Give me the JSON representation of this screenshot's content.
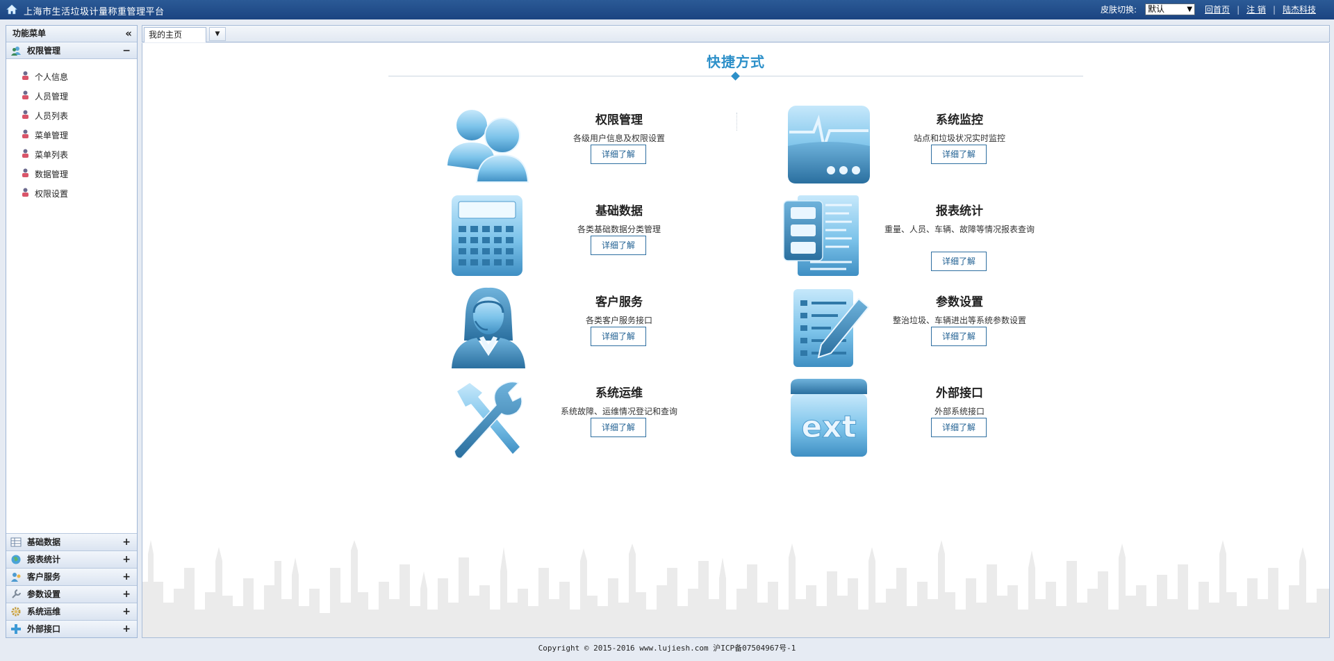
{
  "header": {
    "title": "上海市生活垃圾计量称重管理平台",
    "skin_label": "皮肤切换:",
    "skin_value": "默认",
    "links": [
      "回首页",
      "注 销",
      "陆杰科技"
    ]
  },
  "sidebar": {
    "title": "功能菜单",
    "open_group": {
      "label": "权限管理",
      "toggle": "−",
      "items": [
        "个人信息",
        "人员管理",
        "人员列表",
        "菜单管理",
        "菜单列表",
        "数据管理",
        "权限设置"
      ]
    },
    "groups": [
      {
        "label": "基础数据",
        "toggle": "+"
      },
      {
        "label": "报表统计",
        "toggle": "+"
      },
      {
        "label": "客户服务",
        "toggle": "+"
      },
      {
        "label": "参数设置",
        "toggle": "+"
      },
      {
        "label": "系统运维",
        "toggle": "+"
      },
      {
        "label": "外部接口",
        "toggle": "+"
      }
    ]
  },
  "tabs": {
    "active": "我的主页"
  },
  "quick": {
    "title": "快捷方式",
    "button_label": "详细了解",
    "cards": [
      {
        "title": "权限管理",
        "desc": "各级用户信息及权限设置",
        "icon": "users-icon"
      },
      {
        "title": "系统监控",
        "desc": "站点和垃圾状况实时监控",
        "icon": "monitor-icon"
      },
      {
        "title": "基础数据",
        "desc": "各类基础数据分类管理",
        "icon": "calculator-icon"
      },
      {
        "title": "报表统计",
        "desc": "重量、人员、车辆、故障等情况报表查询",
        "icon": "report-icon"
      },
      {
        "title": "客户服务",
        "desc": "各类客户服务接口",
        "icon": "customer-service-icon"
      },
      {
        "title": "参数设置",
        "desc": "整治垃圾、车辆进出等系统参数设置",
        "icon": "settings-pen-icon"
      },
      {
        "title": "系统运维",
        "desc": "系统故障、运维情况登记和查询",
        "icon": "tools-icon"
      },
      {
        "title": "外部接口",
        "desc": "外部系统接口",
        "icon": "ext-icon"
      }
    ]
  },
  "footer": {
    "text": "Copyright © 2015-2016 www.lujiesh.com 沪ICP备07504967号-1"
  },
  "colors": {
    "topbar": "#1b4481",
    "accent": "#2d90c9",
    "button_border": "#2d6ea0"
  }
}
